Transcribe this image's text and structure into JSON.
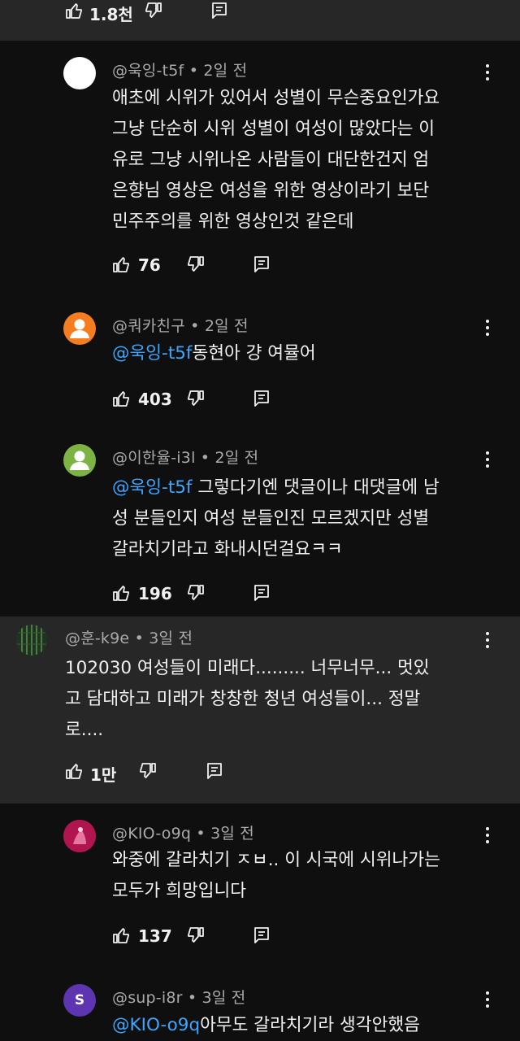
{
  "top_bar": {
    "like_count": "1.8천"
  },
  "comments": [
    {
      "handle": "@욱잉-t5f",
      "time": "2일 전",
      "lines": [
        "애초에 시위가 있어서 성별이 무슨중요인가요",
        "그냥 단순히 시위 성별이 여성이 많았다는 이",
        "유로 그냥 시위나온 사람들이 대단한건지 엄",
        "은향님 영상은 여성을 위한 영상이라기 보단",
        "민주주의를 위한 영상인것 같은데"
      ],
      "likes": "76",
      "avatar_color": "#ffffff"
    },
    {
      "handle": "@쿼카친구",
      "time": "2일 전",
      "mention": "@욱잉-t5f",
      "lines": [
        "동현아 걍 여뮬어"
      ],
      "likes": "403",
      "avatar_color": "#f57c1f"
    },
    {
      "handle": "@이한율-i3l",
      "time": "2일 전",
      "mention": "@욱잉-t5f",
      "lines": [
        " 그렇다기엔 댓글이나 대댓글에 남",
        "성 분들인지 여성 분들인진 모르겠지만 성별",
        "갈라치기라고 화내시던걸요ㅋㅋ"
      ],
      "likes": "196",
      "avatar_color": "#7cb342"
    },
    {
      "handle": "@훈-k9e",
      "time": "3일 전",
      "lines": [
        "102030 여성들이 미래다......... 너무너무... 멋있",
        "고 담대하고 미래가 창창한 청년 여성들이... 정말",
        "로...."
      ],
      "likes": "1만",
      "avatar_color": "#2e4a2a"
    },
    {
      "handle": "@KIO-o9q",
      "time": "3일 전",
      "lines": [
        "와중에 갈라치기 ㅈㅂ.. 이 시국에 시위나가는",
        "모두가 희망입니다"
      ],
      "likes": "137",
      "avatar_color": "#c2185b"
    },
    {
      "handle": "@sup-i8r",
      "time": "3일 전",
      "mention": "@KIO-o9q",
      "lines": [
        "아무도 갈라치기라 생각안했음"
      ],
      "avatar_letter": "S",
      "avatar_color": "#5e35b1"
    }
  ],
  "separator": "•"
}
